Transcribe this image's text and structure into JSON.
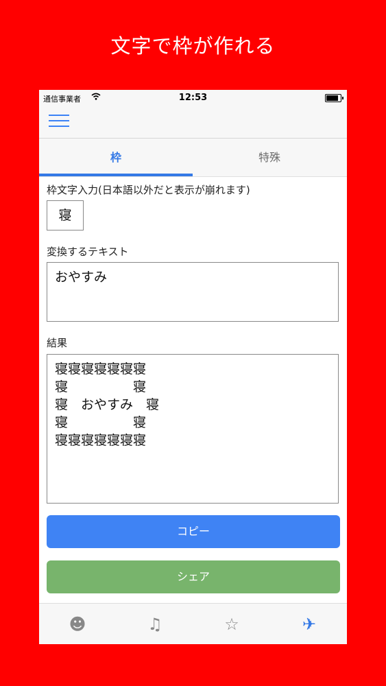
{
  "promo": {
    "title": "文字で枠が作れる"
  },
  "status": {
    "carrier": "通信事業者",
    "time": "12:53"
  },
  "tabs": [
    {
      "label": "枠",
      "active": true
    },
    {
      "label": "特殊",
      "active": false
    }
  ],
  "form": {
    "frame_char_label": "枠文字入力(日本語以外だと表示が崩れます)",
    "frame_char_value": "寝",
    "text_label": "変換するテキスト",
    "text_value": "おやすみ",
    "result_label": "結果",
    "result_value": "寝寝寝寝寝寝寝\n寝　　　　　寝\n寝　おやすみ　寝\n寝　　　　　寝\n寝寝寝寝寝寝寝"
  },
  "buttons": {
    "copy": "コピー",
    "share": "シェア"
  },
  "tabbar": {
    "items": [
      {
        "icon": "smiley-icon",
        "glyph": "☻"
      },
      {
        "icon": "music-note-icon",
        "glyph": "♫"
      },
      {
        "icon": "star-icon",
        "glyph": "☆"
      },
      {
        "icon": "paper-plane-icon",
        "glyph": "✈"
      }
    ]
  },
  "colors": {
    "background": "#ff0000",
    "accent": "#3479e6",
    "copy_button": "#3f83f4",
    "share_button": "#78b46c"
  }
}
